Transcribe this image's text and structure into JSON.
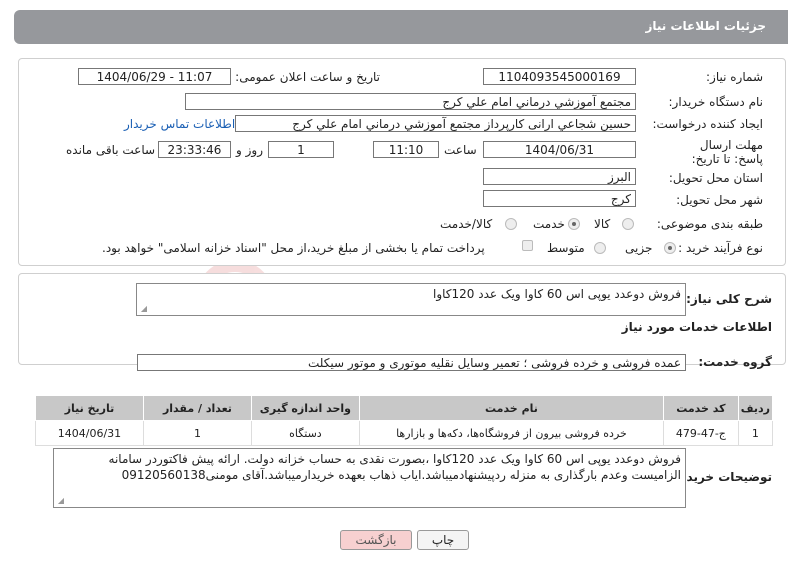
{
  "header": {
    "title": "جزئیات اطلاعات نیاز"
  },
  "form": {
    "need_number_label": "شماره نیاز:",
    "need_number": "1104093545000169",
    "announce_label": "تاریخ و ساعت اعلان عمومی:",
    "announce_value": "1404/06/29 - 11:07",
    "buyer_org_label": "نام دستگاه خریدار:",
    "buyer_org": "مجتمع آموزشي درماني امام علي كرج",
    "creator_label": "ایجاد کننده درخواست:",
    "creator": "حسين شجاعي ارانی كارپرداز مجتمع آموزشي درماني امام علي كرج",
    "buyer_contact_link": "اطلاعات تماس خریدار",
    "deadline_label": "مهلت ارسال پاسخ: تا تاریخ:",
    "deadline_date": "1404/06/31",
    "time_label": "ساعت",
    "deadline_time": "11:10",
    "days_value": "1",
    "days_label": "روز و",
    "remaining_time": "23:33:46",
    "remaining_label": "ساعت باقی مانده",
    "province_label": "استان محل تحویل:",
    "province": "البرز",
    "city_label": "شهر محل تحویل:",
    "city": "كرج",
    "category_label": "طبقه بندی موضوعی:",
    "category_options": [
      "کالا",
      "خدمت",
      "کالا/خدمت"
    ],
    "category_selected": "خدمت",
    "purchase_type_label": "نوع فرآیند خرید :",
    "purchase_options": [
      "جزیی",
      "متوسط"
    ],
    "purchase_selected": "جزیی",
    "treasury_note": "پرداخت تمام یا بخشی از مبلغ خرید،از محل \"اسناد خزانه اسلامی\" خواهد بود."
  },
  "summary": {
    "label": "شرح کلی نیاز:",
    "text": "فروش دوعدد یوپی اس 60 کاوا ویک عدد 120کاوا"
  },
  "services": {
    "section_title": "اطلاعات خدمات مورد نیاز",
    "group_label": "گروه خدمت:",
    "group_value": "عمده فروشی و خرده فروشی ؛ تعمیر وسایل نقلیه موتوری و موتور سیکلت",
    "columns": [
      "ردیف",
      "کد خدمت",
      "نام خدمت",
      "واحد اندازه گیری",
      "تعداد / مقدار",
      "تاریخ نیاز"
    ],
    "rows": [
      [
        "1",
        "ج-47-479",
        "خرده فروشی بیرون از فروشگاه‌ها، دکه‌ها و بازارها",
        "دستگاه",
        "1",
        "1404/06/31"
      ]
    ]
  },
  "buyer_notes": {
    "label": "توضیحات خریدار:",
    "text": "فروش دوعدد یوپی اس 60 کاوا ویک عدد 120کاوا ،بصورت نقدی به حساب خزانه دولت. ارائه پیش فاکتوردر سامانه الزامیست وعدم بارگذاری به منزله ردپیشنهادمیباشد.ایاب ذهاب بعهده خریدارمیباشد.آقای مومنی09120560138"
  },
  "buttons": {
    "print": "چاپ",
    "back": "بازگشت"
  },
  "watermark": {
    "text": "AriaTender.neT"
  },
  "colors": {
    "header_bg": "#96989c",
    "link": "#1a5fb4",
    "back_btn_bg": "#f7d0d0",
    "watermark": "#e8a0a0"
  }
}
